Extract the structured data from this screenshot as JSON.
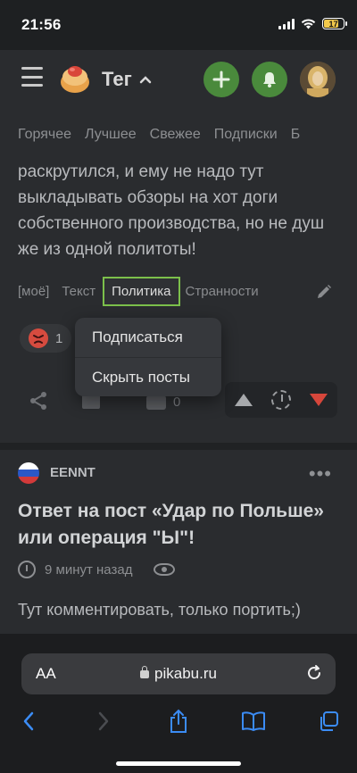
{
  "status_bar": {
    "time": "21:56",
    "battery": "17"
  },
  "header": {
    "brand": "Тег"
  },
  "nav_tabs": [
    "Горячее",
    "Лучшее",
    "Свежее",
    "Подписки",
    "Б"
  ],
  "post1": {
    "text": "раскрутился, и ему не надо тут выкладывать обзоры на хот доги собственного производства, но не душ же из одной политоты!",
    "tags": [
      "[моё]",
      "Текст",
      "Политика",
      "Странности"
    ],
    "active_tag": "Политика",
    "reaction_count": "1",
    "comment_count": "0"
  },
  "tag_menu": {
    "items": [
      "Подписаться",
      "Скрыть посты"
    ]
  },
  "post2": {
    "author": "EENNT",
    "title": "Ответ на пост «Удар по Польше» или операция \"Ы\"!",
    "time": "9 минут назад",
    "text": "Тут комментировать, только портить;)"
  },
  "browser": {
    "text_size_label": "AA",
    "url": "pikabu.ru"
  },
  "colors": {
    "accent_green": "#4a8a3c",
    "tag_highlight": "#7cc04b",
    "downvote_red": "#d6463b",
    "app_bg": "#2a2c2f"
  }
}
